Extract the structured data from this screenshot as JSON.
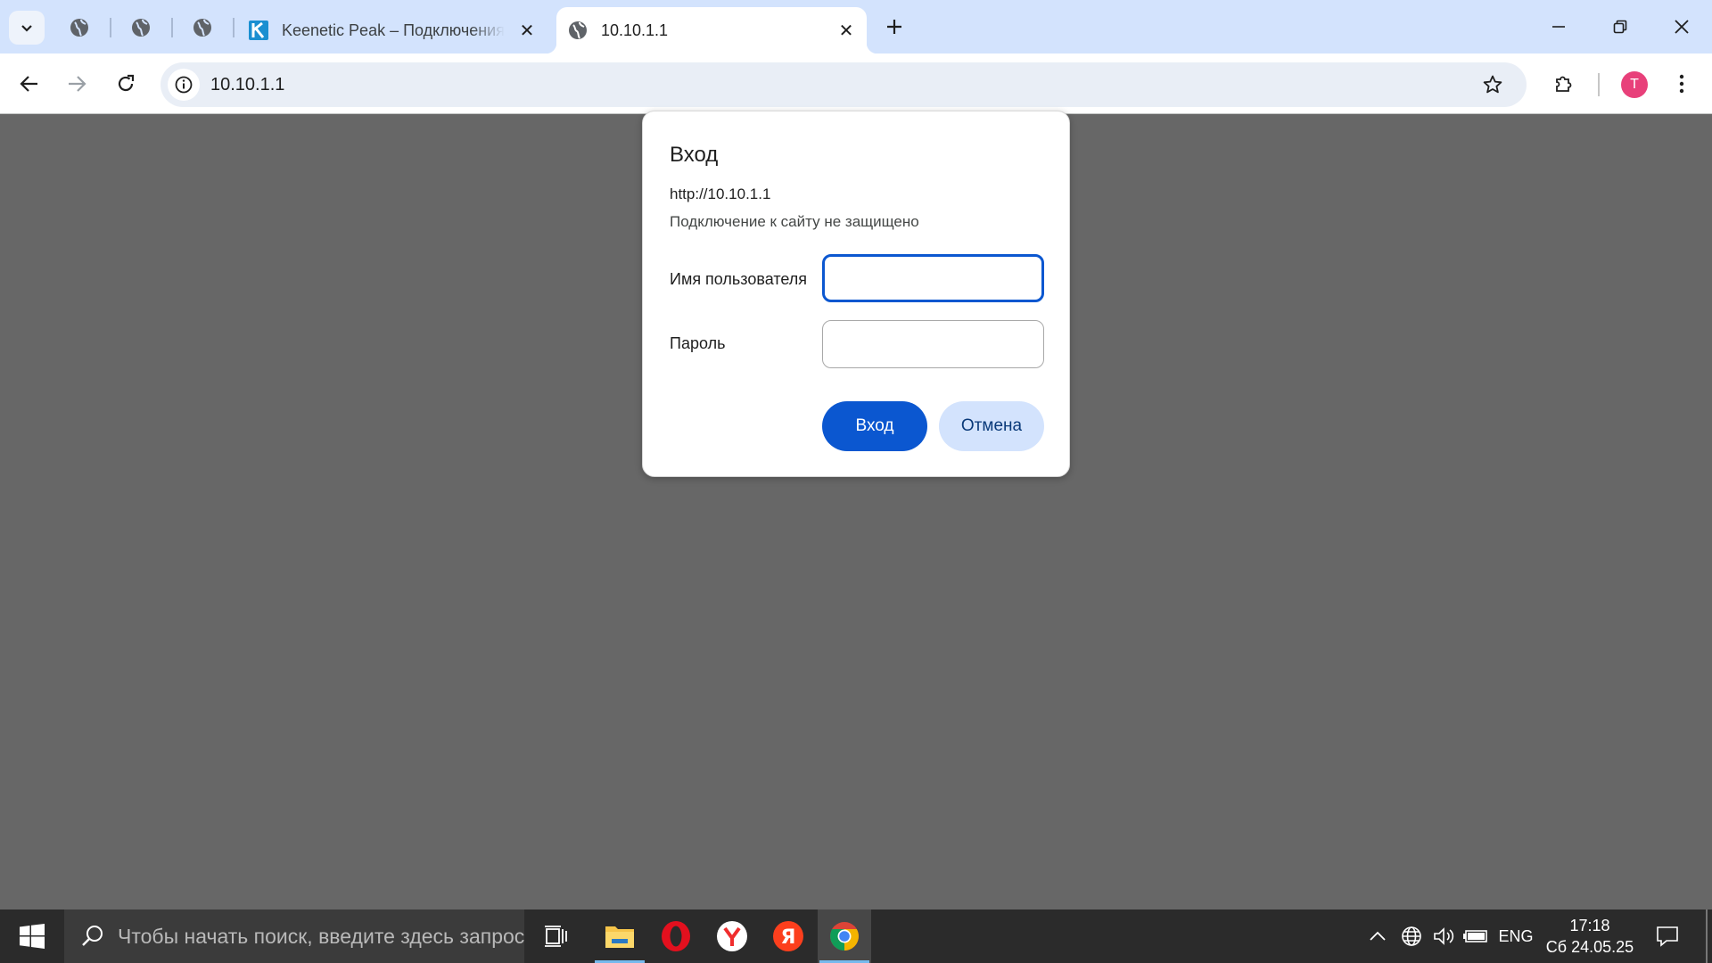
{
  "browser": {
    "tabs": [
      {
        "title": "Keenetic Peak – Подключения",
        "state": "inactive"
      },
      {
        "title": "10.10.1.1",
        "state": "active"
      }
    ],
    "pinned_tab_icons": [
      "globe-icon",
      "globe-icon",
      "globe-icon"
    ],
    "address": "10.10.1.1",
    "profile_initial": "T",
    "accent_color": "#0b57d0",
    "tabstrip_color": "#d3e3fd"
  },
  "dialog": {
    "title": "Вход",
    "origin": "http://10.10.1.1",
    "warning": "Подключение к сайту не защищено",
    "username_label": "Имя пользователя",
    "username_value": "",
    "password_label": "Пароль",
    "password_value": "",
    "login_button": "Вход",
    "cancel_button": "Отмена"
  },
  "taskbar": {
    "search_placeholder": "Чтобы начать поиск, введите здесь запрос",
    "apps": [
      "task-view-icon",
      "file-explorer-icon",
      "opera-icon",
      "yandex-browser-icon",
      "yandex-icon",
      "chrome-icon"
    ],
    "language": "ENG",
    "time": "17:18",
    "date": "Сб 24.05.25"
  }
}
